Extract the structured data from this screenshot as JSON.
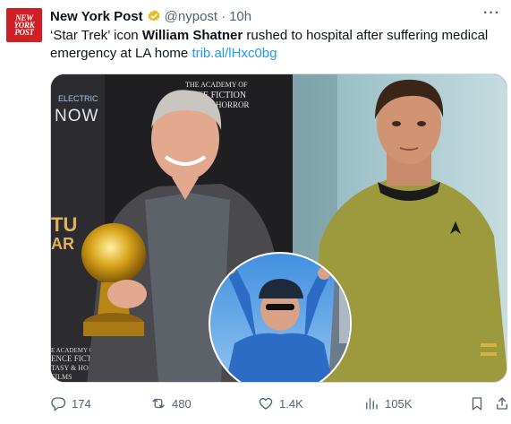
{
  "account": {
    "avatar_line1": "NEW",
    "avatar_line2": "YORK",
    "avatar_line3": "POST",
    "name": "New York Post",
    "handle": "@nypost",
    "separator": "·",
    "time": "10h",
    "verified_icon": "verified-gold-badge"
  },
  "tweet": {
    "text_part1": "‘Star Trek’ icon ",
    "text_bold": "William Shatner",
    "text_part2": " rushed to hospital after suffering medical emergency at LA home ",
    "link": "trib.al/lHxc0bg"
  },
  "media": {
    "backdrop_text_left": "ELECTRIC NOW",
    "backdrop_text_right": "THE ACADEMY OF SCIENCE FICTION FANTASY & HORROR FILMS",
    "backdrop_bottom": "ACADEMY SCIENCE FICTION FANTASY & HORROR FILMS"
  },
  "actions": {
    "replies": "174",
    "reposts": "480",
    "likes": "1.4K",
    "views": "105K"
  },
  "colors": {
    "link": "#1d9bf0",
    "muted": "#536471",
    "brand_red": "#d11f26",
    "verified_gold": "#e8b829"
  }
}
